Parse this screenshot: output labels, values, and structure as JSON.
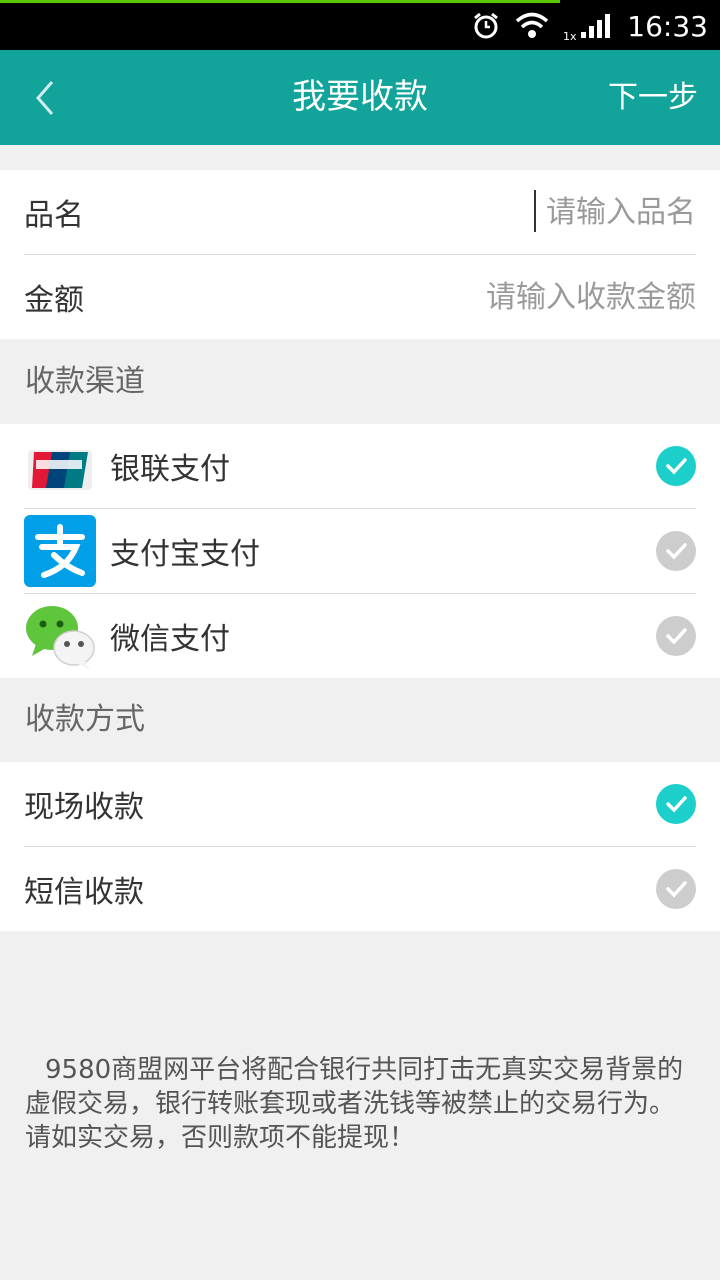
{
  "status_bar": {
    "time": "16:33",
    "icons": [
      "alarm-icon",
      "wifi-icon",
      "signal-icon"
    ],
    "signal_tag": "1x"
  },
  "app_bar": {
    "title": "我要收款",
    "next_label": "下一步"
  },
  "form": {
    "product_label": "品名",
    "product_placeholder": "请输入品名",
    "product_value": "",
    "amount_label": "金额",
    "amount_placeholder": "请输入收款金额",
    "amount_value": ""
  },
  "channels": {
    "header": "收款渠道",
    "items": [
      {
        "label": "银联支付",
        "icon": "unionpay-logo-icon",
        "checked": true
      },
      {
        "label": "支付宝支付",
        "icon": "alipay-logo-icon",
        "checked": false
      },
      {
        "label": "微信支付",
        "icon": "wechat-logo-icon",
        "checked": false
      }
    ]
  },
  "methods": {
    "header": "收款方式",
    "items": [
      {
        "label": "现场收款",
        "checked": true
      },
      {
        "label": "短信收款",
        "checked": false
      }
    ]
  },
  "notice": "9580商盟网平台将配合银行共同打击无真实交易背景的虚假交易，银行转账套现或者洗钱等被禁止的交易行为。请如实交易，否则款项不能提现！",
  "colors": {
    "app_bar": "#12a39b",
    "check_on": "#1ccfcb",
    "check_off": "#cdcdcd",
    "background": "#f0f0f0"
  }
}
